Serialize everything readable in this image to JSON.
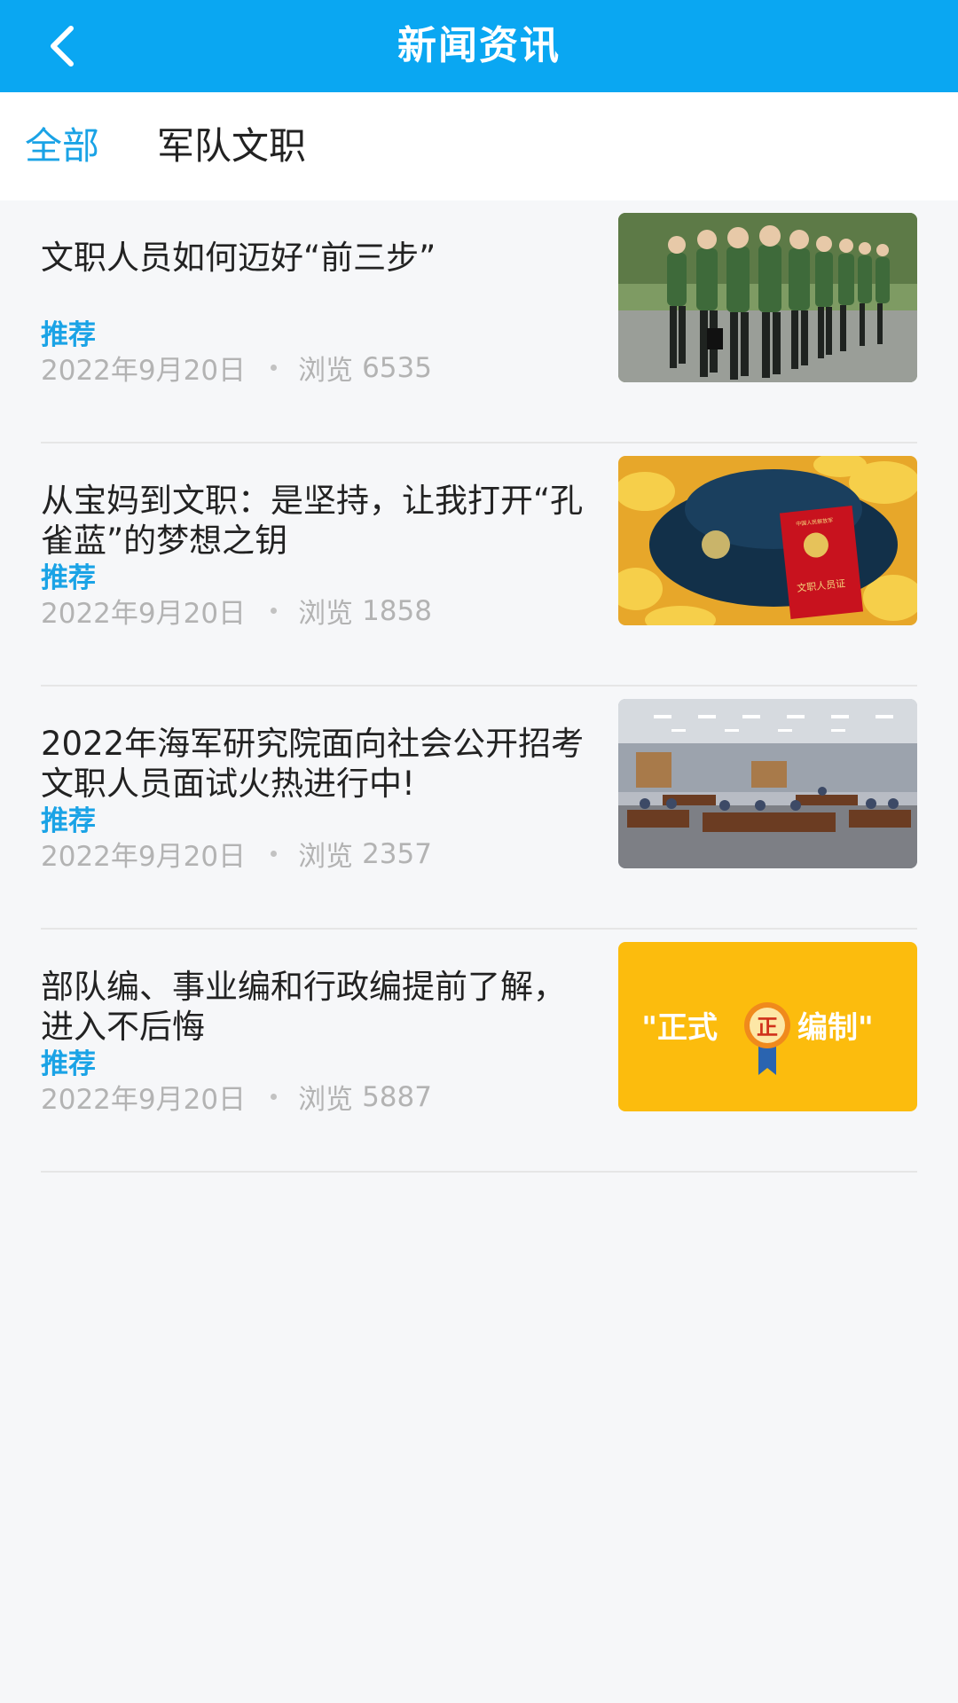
{
  "header": {
    "title": "新闻资讯",
    "back_icon": "chevron-left-icon",
    "background": "#0aa7f2"
  },
  "tabs": [
    {
      "label": "全部",
      "active": true
    },
    {
      "label": "军队文职",
      "active": false
    }
  ],
  "accent_color": "#1aa3e6",
  "news": [
    {
      "title": "文职人员如何迈好“前三步”",
      "tag": "推荐",
      "date": "2022年9月20日",
      "views_label": "浏览",
      "views": "6535"
    },
    {
      "title": "从宝妈到文职：是坚持，让我打开“孔雀蓝”的梦想之钥",
      "tag": "推荐",
      "date": "2022年9月20日",
      "views_label": "浏览",
      "views": "1858",
      "thumb_text": {
        "booklet": "文职人员证",
        "booklet_top": "中国人民解放军"
      }
    },
    {
      "title": "2022年海军研究院面向社会公开招考文职人员面试火热进行中!",
      "tag": "推荐",
      "date": "2022年9月20日",
      "views_label": "浏览",
      "views": "2357"
    },
    {
      "title": "部队编、事业编和行政编提前了解，进入不后悔",
      "tag": "推荐",
      "date": "2022年9月20日",
      "views_label": "浏览",
      "views": "5887",
      "thumb_text": {
        "left": "\"正式",
        "badge": "正",
        "right": "编制\""
      }
    }
  ]
}
